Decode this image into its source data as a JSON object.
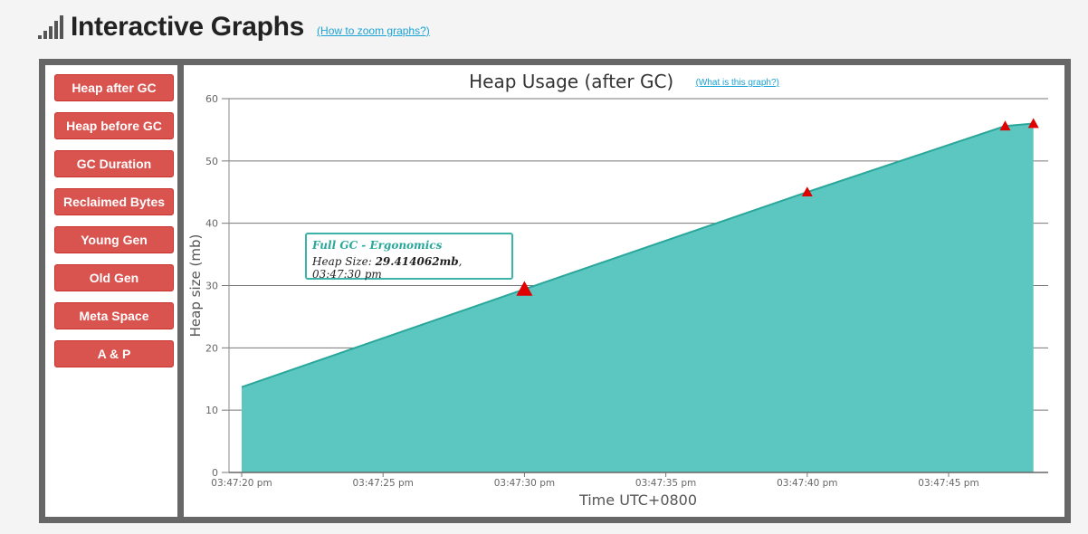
{
  "header": {
    "title": "Interactive Graphs",
    "help_link": "(How to zoom graphs?)",
    "icon": "signal-bars-icon"
  },
  "sidebar": {
    "buttons": [
      {
        "label": "Heap after GC"
      },
      {
        "label": "Heap before GC"
      },
      {
        "label": "GC Duration"
      },
      {
        "label": "Reclaimed Bytes"
      },
      {
        "label": "Young Gen"
      },
      {
        "label": "Old Gen"
      },
      {
        "label": "Meta Space"
      },
      {
        "label": "A & P"
      }
    ],
    "button_color": "#d9534f"
  },
  "chart": {
    "help_link": "(What is this graph?)"
  },
  "tooltip": {
    "title": "Full GC - Ergonomics",
    "prefix": "Heap Size: ",
    "value": "29.414062mb",
    "suffix": ", 03:47:30 pm"
  },
  "chart_data": {
    "type": "area",
    "title": "Heap Usage (after GC)",
    "xlabel": "Time UTC+0800",
    "ylabel": "Heap size (mb)",
    "ylim": [
      0,
      60
    ],
    "yticks": [
      0,
      10,
      20,
      30,
      40,
      50,
      60
    ],
    "xlim_seconds_after_first": [
      -1,
      48
    ],
    "xticks": [
      {
        "t": 0,
        "label": "03:47:20 pm"
      },
      {
        "t": 5,
        "label": "03:47:25 pm"
      },
      {
        "t": 10,
        "label": "03:47:30 pm"
      },
      {
        "t": 15,
        "label": "03:47:35 pm"
      },
      {
        "t": 20,
        "label": "03:47:40 pm"
      },
      {
        "t": 25,
        "label": "03:47:45 pm"
      }
    ],
    "grid": true,
    "fill_color": "#5bc7c0",
    "line_color": "#2aa79b",
    "marker_color": "#e00000",
    "series": [
      {
        "values": [
          {
            "t": 0,
            "y": 13.7
          },
          {
            "t": 10,
            "y": 29.414062
          },
          {
            "t": 20,
            "y": 45.0
          },
          {
            "t": 27,
            "y": 55.6
          },
          {
            "t": 28,
            "y": 56.0
          }
        ]
      }
    ],
    "markers": [
      {
        "t": 10,
        "y": 29.414062,
        "highlight": true
      },
      {
        "t": 20,
        "y": 45.0
      },
      {
        "t": 27,
        "y": 55.6
      },
      {
        "t": 28,
        "y": 56.0
      }
    ]
  }
}
